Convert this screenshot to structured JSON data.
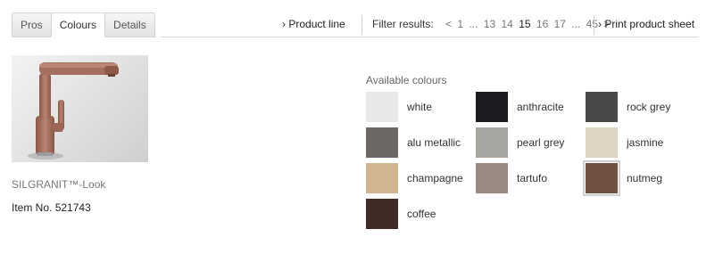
{
  "tabs": [
    {
      "label": "Pros",
      "active": false
    },
    {
      "label": "Colours",
      "active": true
    },
    {
      "label": "Details",
      "active": false
    }
  ],
  "nav": {
    "product_line": "Product line",
    "filter_label": "Filter results:",
    "pager": [
      "<",
      "1",
      "...",
      "13",
      "14",
      "15",
      "16",
      "17",
      "...",
      "45",
      ">"
    ],
    "pager_current": "15",
    "print": "Print product sheet"
  },
  "product": {
    "name": "SILGRANIT™-Look",
    "item_label": "Item No.",
    "item_number": "521743"
  },
  "colours": {
    "title": "Available colours",
    "items": [
      {
        "name": "white",
        "color": "#e8e8e6"
      },
      {
        "name": "anthracite",
        "color": "#1c1d20"
      },
      {
        "name": "rock grey",
        "color": "#4a4849"
      },
      {
        "name": "alu metallic",
        "color": "#6b6866"
      },
      {
        "name": "pearl grey",
        "color": "#a7a6a1"
      },
      {
        "name": "jasmine",
        "color": "#ddd4c3"
      },
      {
        "name": "champagne",
        "color": "#d2b48e"
      },
      {
        "name": "tartufo",
        "color": "#9a8a82"
      },
      {
        "name": "nutmeg",
        "color": "#6e5140"
      },
      {
        "name": "coffee",
        "color": "#3e2c25"
      }
    ],
    "selected": "nutmeg"
  },
  "colors": {
    "tap_finish": "#a5705e"
  }
}
